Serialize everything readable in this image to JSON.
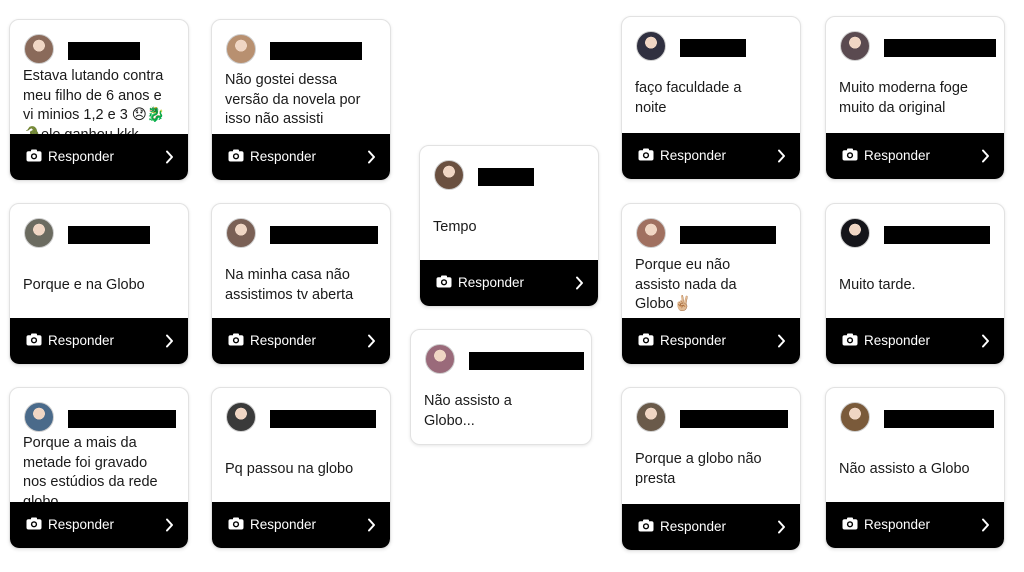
{
  "reply_label": "Responder",
  "colors": {
    "reply_bar": "#000000",
    "text": "#1a1a1a",
    "redaction": "#000000"
  },
  "icons": {
    "reply_icon": "camera-icon",
    "chevron": "chevron-right-icon"
  },
  "cards": [
    {
      "message": "Estava lutando contra\nmeu filho de 6 anos e\nvi minios 1,2 e 3 😞🐉\n🐊ele ganhou kkk",
      "avatar": "#8a6a5a"
    },
    {
      "message": "Não gostei dessa\nversão da novela por\nisso não assisti",
      "avatar": "#b89070"
    },
    {
      "message": "Porque e na Globo",
      "avatar": "#6b6b60"
    },
    {
      "message": "Na minha casa não\nassistimos tv aberta",
      "avatar": "#7a6055"
    },
    {
      "message": "Porque a mais da\nmetade foi gravado\nnos estúdios da rede\nglobo",
      "avatar": "#4a6a8a"
    },
    {
      "message": "Pq passou na globo",
      "avatar": "#3a3a3a"
    },
    {
      "message": "Tempo",
      "avatar": "#6a5040"
    },
    {
      "message": "Não assisto a\nGlobo...",
      "avatar": "#9a6a7a"
    },
    {
      "message": "faço faculdade a\nnoite",
      "avatar": "#303040"
    },
    {
      "message": "Muito moderna foge\nmuito da original",
      "avatar": "#5a4a50"
    },
    {
      "message": "Porque eu não\nassisto nada da\nGlobo✌🏼",
      "avatar": "#a07060"
    },
    {
      "message": "Muito tarde.",
      "avatar": "#15151a"
    },
    {
      "message": "Porque a globo não\npresta",
      "avatar": "#6a5a4a"
    },
    {
      "message": "Não assisto a Globo",
      "avatar": "#7a5a3a"
    }
  ]
}
